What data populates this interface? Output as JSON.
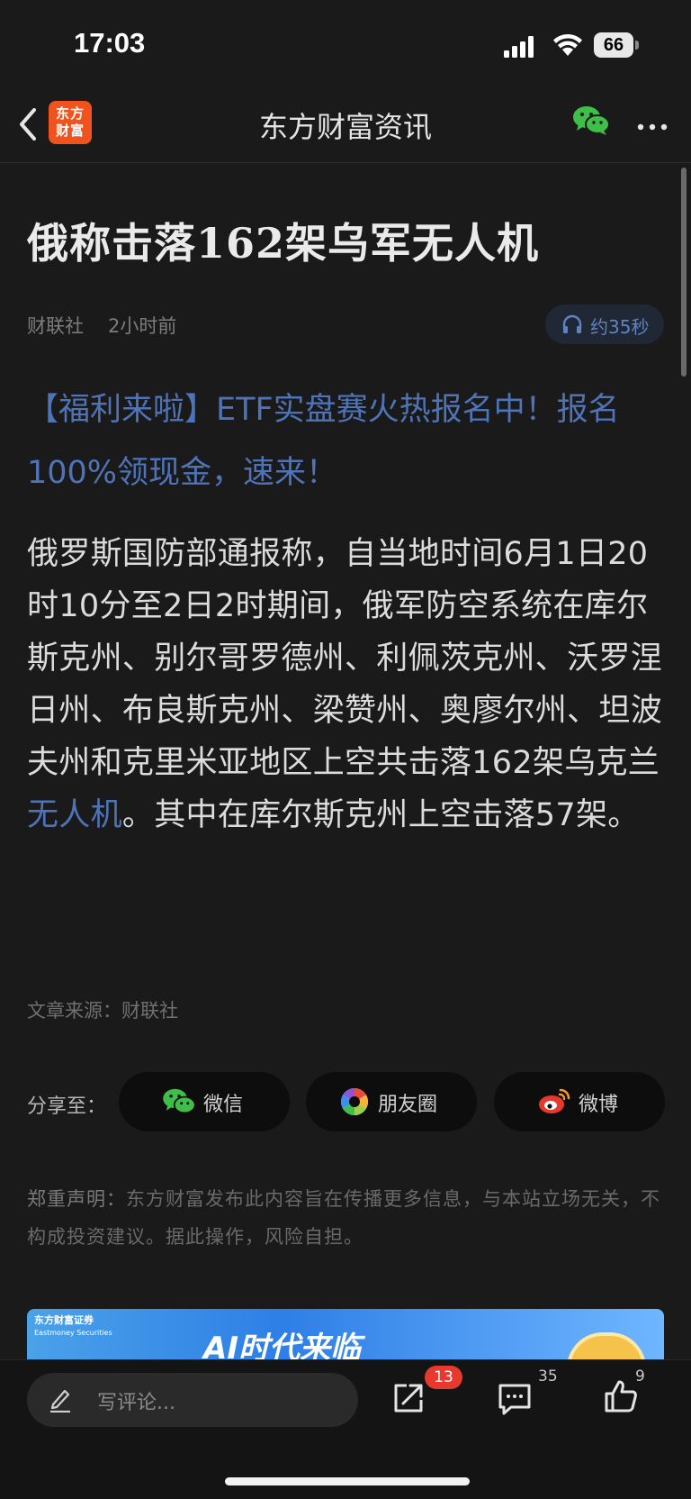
{
  "status_bar": {
    "time": "17:03",
    "battery": "66"
  },
  "nav": {
    "title": "东方财富资讯",
    "logo_line1": "东方",
    "logo_line2": "财富"
  },
  "article": {
    "headline": "俄称击落162架乌军无人机",
    "source": "财联社",
    "time": "2小时前",
    "audio_label": "约35秒",
    "promo": "【福利来啦】ETF实盘赛火热报名中！报名100%领现金，速来！",
    "body_before_link": "俄罗斯国防部通报称，自当地时间6月1日20时10分至2日2时期间，俄军防空系统在库尔斯克州、别尔哥罗德州、利佩茨克州、沃罗涅日州、布良斯克州、梁赞州、奥廖尔州、坦波夫州和克里米亚地区上空共击落162架乌克兰",
    "body_link": "无人机",
    "body_after_link": "。其中在库尔斯克州上空击落57架。",
    "source_line": "文章来源：财联社"
  },
  "share": {
    "label": "分享至：",
    "wechat": "微信",
    "moments": "朋友圈",
    "weibo": "微博"
  },
  "disclaimer": {
    "label": "郑重声明：",
    "text": "东方财富发布此内容旨在传播更多信息，与本站立场无关，不构成投资建议。据此操作，风险自担。"
  },
  "banner": {
    "logo_text": "东方财富证券",
    "logo_sub": "Eastmoney Securities",
    "title": "AI时代来临"
  },
  "bottom_bar": {
    "comment_placeholder": "写评论...",
    "share_badge": "13",
    "comment_count": "35",
    "like_count": "9"
  },
  "colors": {
    "accent_link": "#4f73b7",
    "badge_red": "#e8392f",
    "logo_orange": "#f0531e"
  }
}
